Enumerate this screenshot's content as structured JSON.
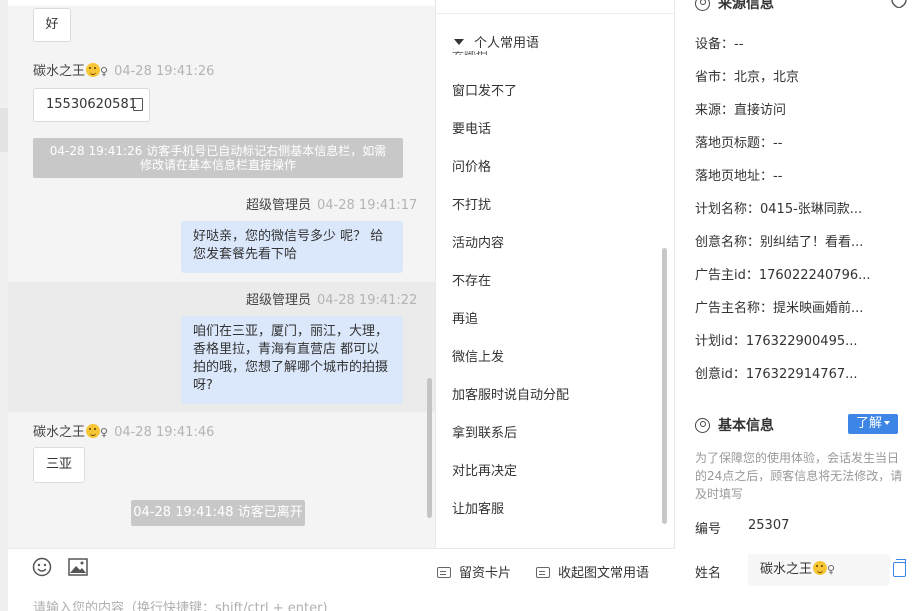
{
  "chat": {
    "partial_header": {
      "left": "...",
      "right": "..."
    },
    "messages": {
      "m1_text": "好",
      "m2_sender": "碳水之王",
      "m2_time": "04-28 19:41:26",
      "m2_text": "15530620581",
      "sys1_line1": "04-28 19:41:26 访客手机号已自动标记右侧基本信息栏，如需",
      "sys1_line2": "修改请在基本信息栏直接操作",
      "m3_sender": "超级管理员",
      "m3_time": "04-28 19:41:17",
      "m3_line1": "好哒亲，您的微信号多少 呢？ 给",
      "m3_line2": "您发套餐先看下哈",
      "m4_sender": "超级管理员",
      "m4_time": "04-28 19:41:22",
      "m4_line1": "咱们在三亚，厦门，丽江，大理，",
      "m4_line2": "香格里拉，青海有直营店 都可以",
      "m4_line3": "拍的哦，您想了解哪个城市的拍摄",
      "m4_line4": "呀?",
      "m5_sender": "碳水之王",
      "m5_time": "04-28 19:41:46",
      "m5_text": "三亚",
      "sys2": "04-28 19:41:48 访客已离开"
    },
    "gender_symbol": "♀"
  },
  "toolbar": {
    "emoji_icon": "smile-icon",
    "image_icon": "image-icon",
    "card_label": "留资卡片",
    "rich_label": "收起图文常用语",
    "input_placeholder": "请输入您的内容（换行快捷键：shift/ctrl + enter)"
  },
  "phrases": {
    "header": "个人常用语",
    "peek": "去哪拍",
    "items": [
      "窗口发不了",
      "要电话",
      "问价格",
      "不打扰",
      "活动内容",
      "不存在",
      "再追",
      "微信上发",
      "加客服时说自动分配",
      "拿到联系后",
      "对比再决定",
      "让加客服"
    ]
  },
  "info": {
    "source_title": "来源信息",
    "rows": [
      "设备：--",
      "省市：北京，北京",
      "来源：直接访问",
      "落地页标题：--",
      "落地页地址：--",
      "计划名称：0415-张琳同款...",
      "创意名称：别纠结了！看看...",
      "广告主id：176022240796...",
      "广告主名称：提米映画婚前...",
      "计划id：176322900495...",
      "创意id：176322914767..."
    ],
    "basic_title": "基本信息",
    "know_btn": "了解",
    "notice": "为了保障您的使用体验，会话发生当日的24点之后，顾客信息将无法修改，请及时填写",
    "id_label": "编号",
    "id_value": "25307",
    "name_label": "姓名",
    "name_value": "碳水之王"
  },
  "colors": {
    "accent": "#3d86e6",
    "bubble_out": "#dbe8fb",
    "system": "#c8c8c8"
  }
}
